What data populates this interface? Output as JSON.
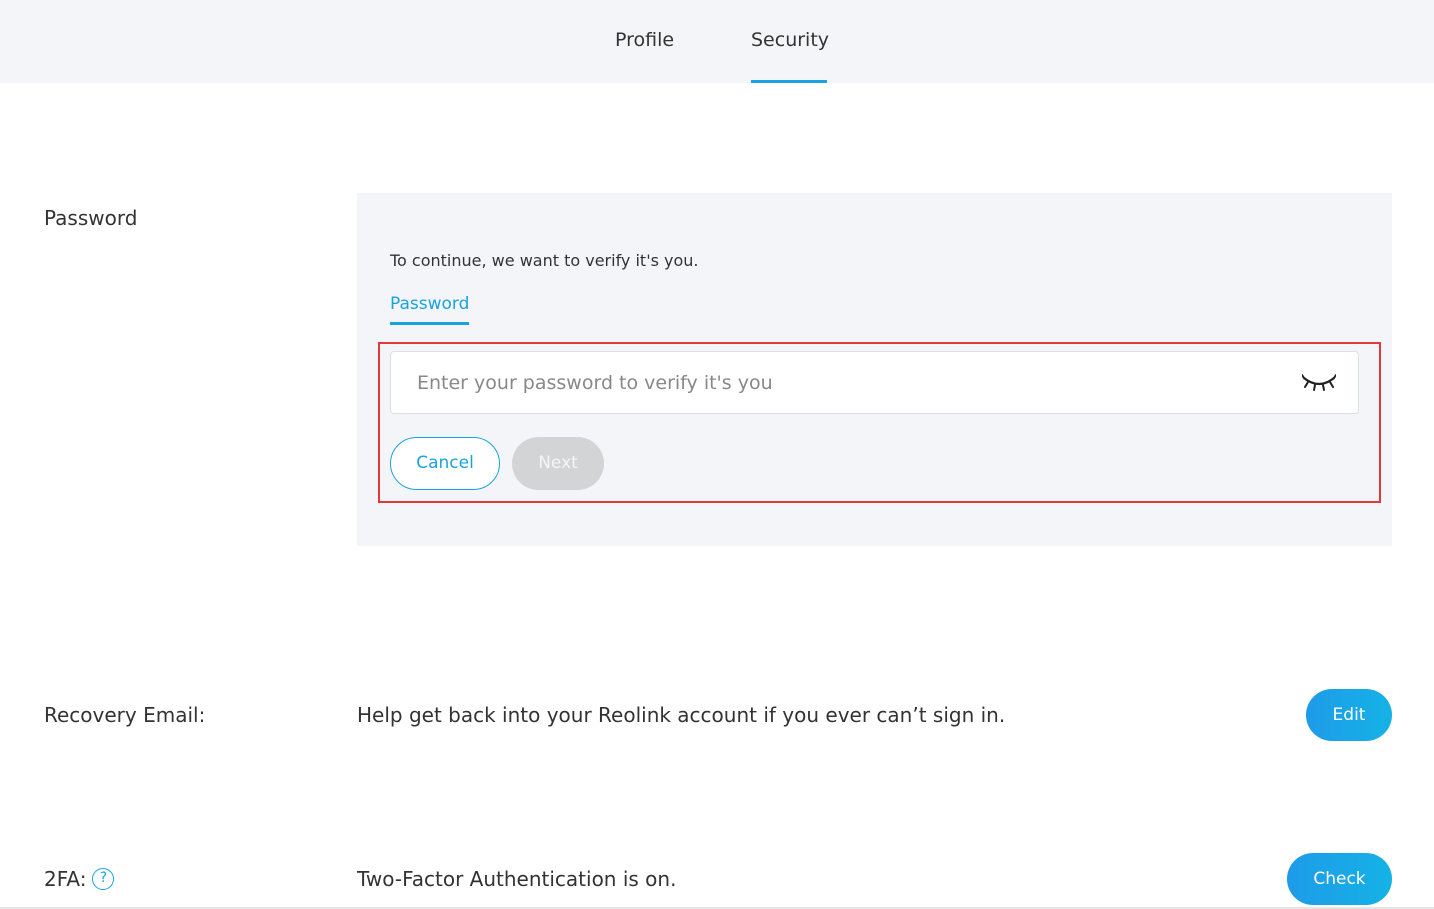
{
  "tabs": {
    "profile": "Profile",
    "security": "Security"
  },
  "password_section": {
    "label": "Password",
    "verify_text": "To continue, we want to verify it's you.",
    "subtab": "Password",
    "input_placeholder": "Enter your password to verify it's you",
    "input_value": "",
    "toggle_icon": "eye-closed-icon",
    "cancel_label": "Cancel",
    "next_label": "Next"
  },
  "recovery_email": {
    "label": "Recovery Email:",
    "description": "Help get back into your Reolink account if you ever can’t sign in.",
    "button_label": "Edit"
  },
  "two_fa": {
    "label": "2FA:",
    "help_icon": "question-circle-icon",
    "help_glyph": "?",
    "description": "Two-Factor Authentication is on.",
    "button_label": "Check"
  },
  "colors": {
    "accent": "#18a3de",
    "highlight_border": "#e03b37",
    "panel_bg": "#f4f5f8",
    "disabled_button": "#d3d4d6"
  }
}
